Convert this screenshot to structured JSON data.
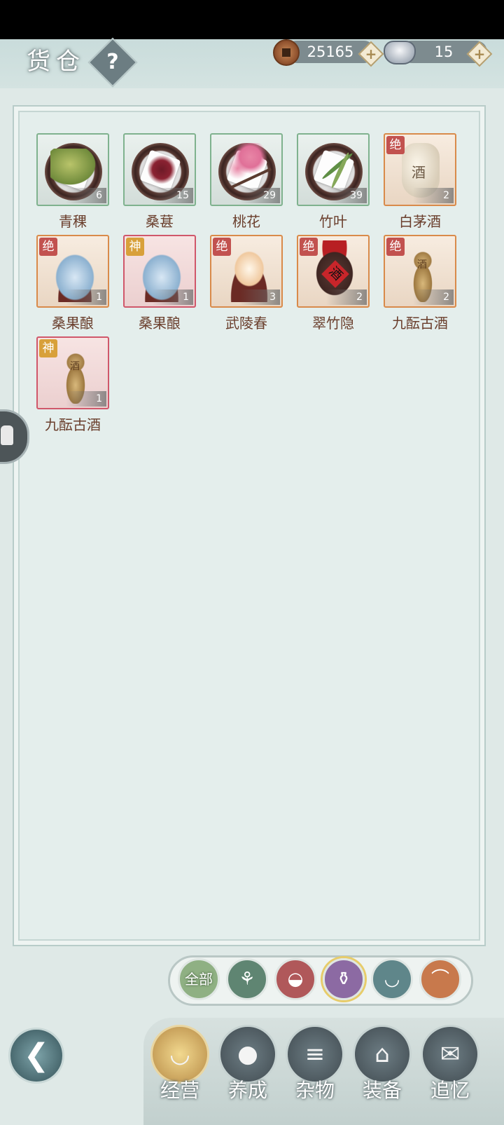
{
  "header": {
    "title": "货仓",
    "help_label": "?",
    "coins": "25165",
    "silver": "15",
    "plus_label": "+"
  },
  "items": [
    {
      "name": "青稞",
      "count": "6",
      "rank": "",
      "graphic": "wheat"
    },
    {
      "name": "桑葚",
      "count": "15",
      "rank": "",
      "graphic": "berry"
    },
    {
      "name": "桃花",
      "count": "29",
      "rank": "",
      "graphic": "blossom"
    },
    {
      "name": "竹叶",
      "count": "39",
      "rank": "",
      "graphic": "bamboo"
    },
    {
      "name": "白茅酒",
      "count": "2",
      "rank": "绝",
      "graphic": "jar"
    },
    {
      "name": "桑果酿",
      "count": "1",
      "rank": "绝",
      "graphic": "ewer"
    },
    {
      "name": "桑果酿",
      "count": "1",
      "rank": "神",
      "graphic": "ewer"
    },
    {
      "name": "武陵春",
      "count": "3",
      "rank": "绝",
      "graphic": "flask"
    },
    {
      "name": "翠竹隐",
      "count": "2",
      "rank": "绝",
      "graphic": "crock"
    },
    {
      "name": "九酝古酒",
      "count": "2",
      "rank": "绝",
      "graphic": "gourd"
    },
    {
      "name": "九酝古酒",
      "count": "1",
      "rank": "神",
      "graphic": "gourd"
    }
  ],
  "filters": [
    {
      "label": "全部",
      "icon": "all-icon",
      "color": "#8fb083",
      "active": false
    },
    {
      "label": "",
      "icon": "sprout-icon",
      "color": "#5f8572",
      "active": false
    },
    {
      "label": "",
      "icon": "food-bowl-icon",
      "color": "#b0585a",
      "active": false
    },
    {
      "label": "",
      "icon": "wine-jar-icon",
      "color": "#8c6aa3",
      "active": true
    },
    {
      "label": "",
      "icon": "mortar-icon",
      "color": "#5f868a",
      "active": false
    },
    {
      "label": "",
      "icon": "feather-icon",
      "color": "#c8794c",
      "active": false
    }
  ],
  "nav": [
    {
      "label": "经营",
      "icon": "bowl-icon",
      "active": true
    },
    {
      "label": "养成",
      "icon": "crystal-ball-icon",
      "active": false
    },
    {
      "label": "杂物",
      "icon": "bundle-icon",
      "active": false
    },
    {
      "label": "装备",
      "icon": "robe-icon",
      "active": false
    },
    {
      "label": "追忆",
      "icon": "letter-icon",
      "active": false
    }
  ],
  "colors": {
    "jue_badge": "#c2524f",
    "shen_badge": "#d8a03a",
    "name_text": "#6a3e2c"
  }
}
